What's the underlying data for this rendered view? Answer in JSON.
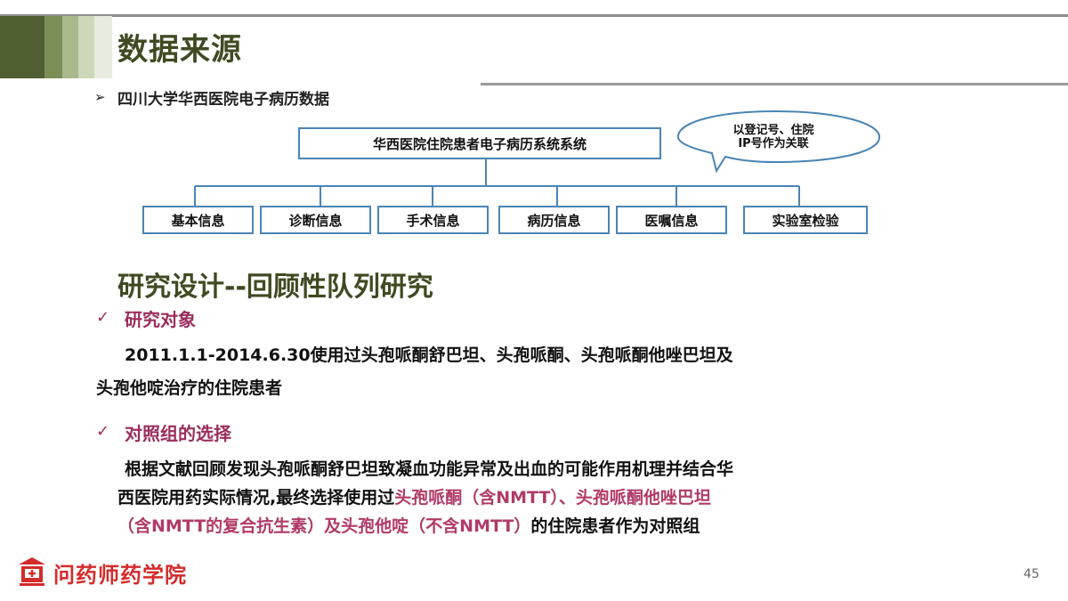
{
  "header": {
    "title": "数据来源",
    "source_label": "四川大学华西医院电子病历数据"
  },
  "diagram": {
    "root": "华西医院住院患者电子病历系统系统",
    "children": [
      "基本信息",
      "诊断信息",
      "手术信息",
      "病历信息",
      "医嘱信息",
      "实验室检验"
    ],
    "callout_line1": "以登记号、住院",
    "callout_line2": "IP号作为关联"
  },
  "design": {
    "title": "研究设计--回顾性队列研究",
    "subject_heading": "研究对象",
    "subject_line1": "2011.1.1-2014.6.30使用过头孢哌酮舒巴坦、头孢哌酮、头孢哌酮他唑巴坦及",
    "subject_line2": "头孢他啶治疗的住院患者",
    "control_heading": "对照组的选择",
    "control_line1": "根据文献回顾发现头孢哌酮舒巴坦致凝血功能异常及出血的可能作用机理并结合华",
    "control_line2_plain": "西医院用药实际情况,最终选择使用过",
    "control_line2_highlight": "头孢哌酮（含NMTT）、头孢哌酮他唑巴坦",
    "control_line3_highlight": "（含NMTT的复合抗生素）及头孢他啶（不含NMTT）",
    "control_line3_plain": "的住院患者作为对照组"
  },
  "footer": {
    "logo_text": "问药师药学院",
    "page_number": "45"
  },
  "colors": {
    "title_green": "#3f4a22",
    "accent_pink": "#9b2d5c",
    "box_border": "#4a84b5",
    "logo_red": "#d42b2b"
  }
}
